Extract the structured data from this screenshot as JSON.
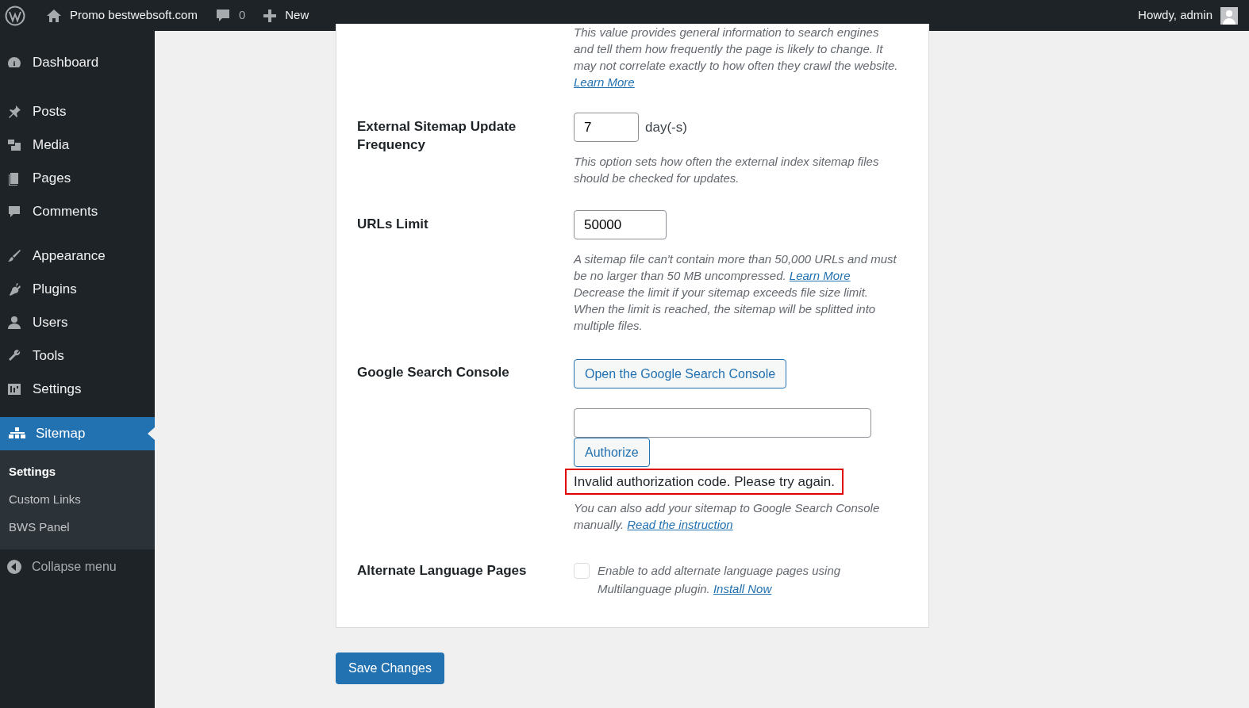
{
  "admin_bar": {
    "site": "Promo bestwebsoft.com",
    "comments": "0",
    "new": "New",
    "greeting": "Howdy, admin"
  },
  "sidebar": {
    "groups": [
      [
        {
          "label": "Dashboard",
          "selected": false
        }
      ],
      [
        {
          "label": "Posts",
          "selected": false
        },
        {
          "label": "Media",
          "selected": false
        },
        {
          "label": "Pages",
          "selected": false
        },
        {
          "label": "Comments",
          "selected": false
        }
      ],
      [
        {
          "label": "Appearance",
          "selected": false
        },
        {
          "label": "Plugins",
          "selected": false
        },
        {
          "label": "Users",
          "selected": false
        },
        {
          "label": "Tools",
          "selected": false
        },
        {
          "label": "Settings",
          "selected": false
        }
      ],
      [
        {
          "label": "Sitemap",
          "selected": true
        }
      ]
    ],
    "submenu": [
      {
        "label": "Settings",
        "selected": true
      },
      {
        "label": "Custom Links",
        "selected": false
      },
      {
        "label": "BWS Panel",
        "selected": false
      }
    ],
    "collapse": "Collapse menu"
  },
  "rows": [
    {
      "kind": "note",
      "parts": [
        {
          "text": "This value provides general information to search engines and tell them how frequently the page is likely to change. It may not correlate exactly to how often they crawl the website. "
        },
        {
          "link": "Learn More"
        }
      ]
    },
    {
      "kind": "number",
      "label": "External Sitemap Update Frequency",
      "value": "7",
      "unit": "day(-s)",
      "parts": [
        {
          "text": "This option sets how often the external index sitemap files should be checked for updates."
        }
      ]
    },
    {
      "kind": "number",
      "label": "URLs Limit",
      "value": "50000",
      "parts": [
        {
          "text": "A sitemap file can't contain more than 50,000 URLs and must be no larger than 50 MB uncompressed. "
        },
        {
          "link": "Learn More"
        },
        {
          "text": " Decrease the limit if your sitemap exceeds file size limit. When the limit is reached, the sitemap will be splitted into multiple files."
        }
      ]
    },
    {
      "kind": "gsc",
      "label": "Google Search Console",
      "button": "Open the Google Search Console",
      "authorize": "Authorize",
      "error": "Invalid authorization code. Please try again.",
      "parts": [
        {
          "text": "You can also add your sitemap to Google Search Console manually. "
        },
        {
          "link": "Read the instruction"
        }
      ]
    },
    {
      "kind": "checkbox",
      "label": "Alternate Language Pages",
      "checked": false,
      "parts": [
        {
          "text": "Enable to add alternate language pages using Multilanguage plugin. "
        },
        {
          "link": "Install Now"
        }
      ]
    }
  ],
  "save": "Save Changes"
}
